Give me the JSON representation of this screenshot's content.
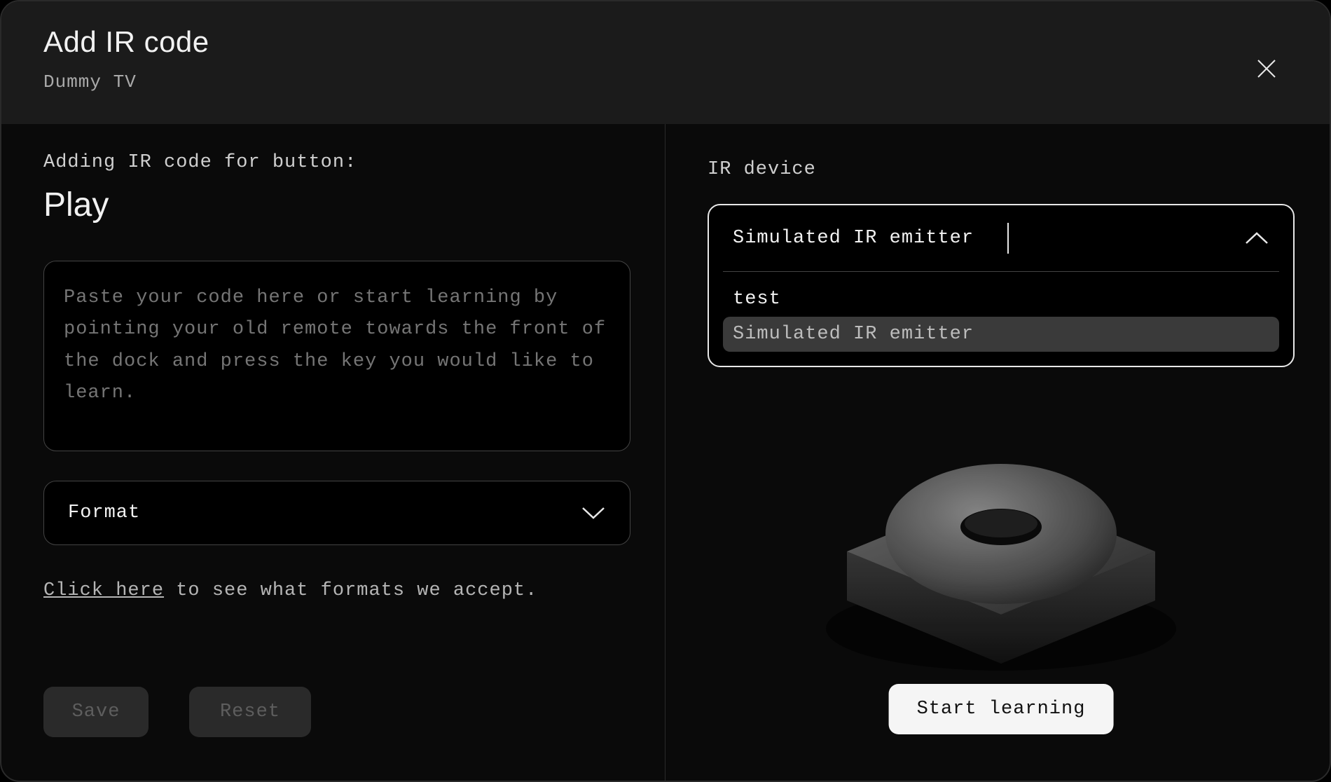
{
  "header": {
    "title": "Add IR code",
    "subtitle": "Dummy TV"
  },
  "left": {
    "adding_label": "Adding IR code for button:",
    "button_name": "Play",
    "code_placeholder": "Paste your code here or start learning by pointing your old remote towards the front of the dock and press the key you would like to learn.",
    "format_label": "Format",
    "hint_link": "Click here",
    "hint_rest": " to see what formats we accept.",
    "save_label": "Save",
    "reset_label": "Reset"
  },
  "right": {
    "ir_device_label": "IR device",
    "dropdown_value": "Simulated IR emitter",
    "options": [
      "test",
      "Simulated IR emitter"
    ],
    "start_label": "Start learning"
  }
}
